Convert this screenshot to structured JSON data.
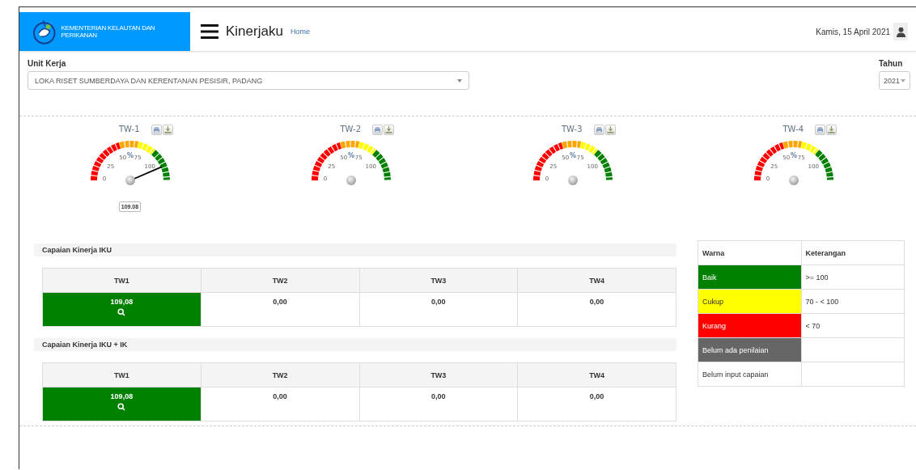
{
  "header": {
    "brand": "KEMENTERIAN KELAUTAN DAN PERIKANAN",
    "app_title": "Kinerjaku",
    "breadcrumb": "Home",
    "date": "Kamis, 15 April 2021"
  },
  "filters": {
    "unit_label": "Unit Kerja",
    "unit_value": "LOKA RISET SUMBERDAYA DAN KERENTANAN PESISIR, PADANG",
    "year_label": "Tahun",
    "year_value": "2021"
  },
  "gauges": [
    {
      "title": "TW-1",
      "unit": "%",
      "scale": [
        "0",
        "25",
        "50",
        "75",
        "100"
      ],
      "level": 0.87,
      "reading": "109.08"
    },
    {
      "title": "TW-2",
      "unit": "%",
      "scale": [
        "0",
        "25",
        "50",
        "75",
        "100"
      ]
    },
    {
      "title": "TW-3",
      "unit": "%",
      "scale": [
        "0",
        "25",
        "50",
        "75",
        "100"
      ]
    },
    {
      "title": "TW-4",
      "unit": "%",
      "scale": [
        "0",
        "25",
        "50",
        "75",
        "100"
      ]
    }
  ],
  "sections": [
    {
      "title": "Capaian Kinerja IKU",
      "columns": [
        "TW1",
        "TW2",
        "TW3",
        "TW4"
      ],
      "cells": [
        {
          "value": "109,08",
          "color": "#008000",
          "detail": true
        },
        {
          "value": "0,00"
        },
        {
          "value": "0,00"
        },
        {
          "value": "0,00"
        }
      ]
    },
    {
      "title": "Capaian Kinerja IKU + IK",
      "columns": [
        "TW1",
        "TW2",
        "TW3",
        "TW4"
      ],
      "cells": [
        {
          "value": "109,08",
          "color": "#008000",
          "detail": true
        },
        {
          "value": "0,00"
        },
        {
          "value": "0,00"
        },
        {
          "value": "0,00"
        }
      ]
    }
  ],
  "legend": {
    "columns": [
      "Warna",
      "Keterangan"
    ],
    "rows": [
      {
        "label": "Baik",
        "color": "#008000",
        "description": ">= 100"
      },
      {
        "label": "Cukup",
        "color": "#ffff00",
        "description": "70 - < 100"
      },
      {
        "label": "Kurang",
        "color": "#ff0000",
        "description": "< 70"
      },
      {
        "label": "Belum ada penilaian",
        "color": "#666666"
      },
      {
        "label": "Belum input capaian"
      }
    ]
  }
}
